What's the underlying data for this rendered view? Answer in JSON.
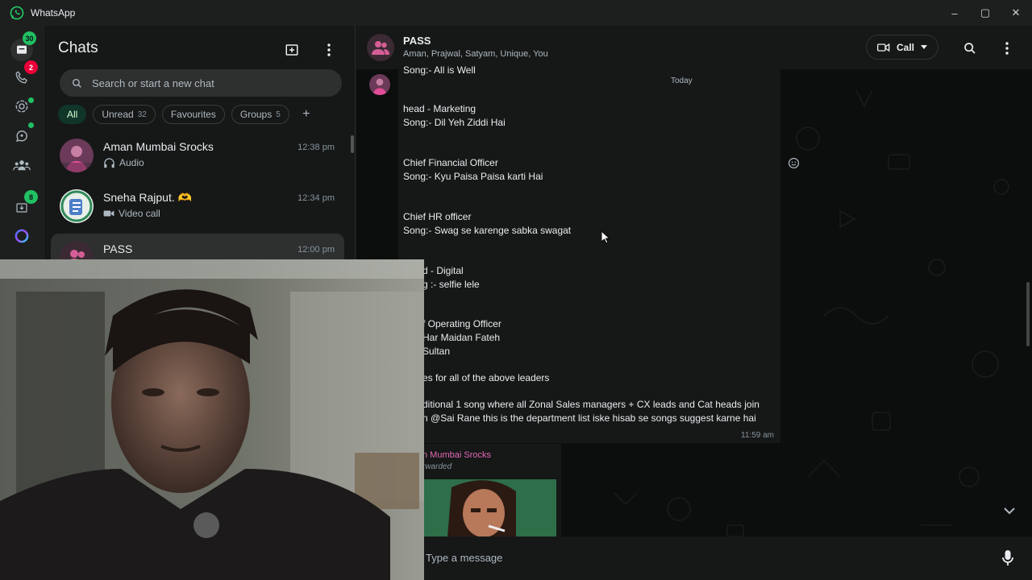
{
  "app": {
    "title": "WhatsApp",
    "brand_color": "#25d366"
  },
  "window_controls": {
    "minimize": "–",
    "maximize": "▢",
    "close": "✕"
  },
  "rail": {
    "chats_badge": "30",
    "calls_badge": "2",
    "archive_badge": "8",
    "icons": [
      "chats-icon",
      "calls-icon",
      "status-icon",
      "channels-icon",
      "communities-icon",
      "archive-icon",
      "meta-ai-icon"
    ]
  },
  "chat_list": {
    "title": "Chats",
    "search_placeholder": "Search or start a new chat",
    "filters": [
      {
        "label": "All",
        "count": ""
      },
      {
        "label": "Unread",
        "count": "32"
      },
      {
        "label": "Favourites",
        "count": ""
      },
      {
        "label": "Groups",
        "count": "5"
      }
    ],
    "add_filter": "+",
    "items": [
      {
        "name": "Aman Mumbai Srocks",
        "time": "12:38 pm",
        "preview": "Audio",
        "preview_icon": "headphones-icon"
      },
      {
        "name": "Sneha Rajput. 🫶",
        "time": "12:34 pm",
        "preview": "Video call",
        "preview_icon": "video-icon"
      },
      {
        "name": "PASS",
        "time": "12:00 pm",
        "preview": "",
        "preview_icon": ""
      }
    ]
  },
  "conversation": {
    "name": "PASS",
    "members": "Aman, Prajwal, Satyam, Unique, You",
    "call_label": "Call",
    "date_chip": "Today",
    "message_lines": [
      "Song:- All is Well",
      "head -  Marketing",
      "Song:- Dil Yeh Ziddi Hai",
      "Chief Financial Officer",
      "Song:- Kyu Paisa Paisa karti Hai",
      "Chief HR officer",
      "Song:- Swag se karenge sabka swagat",
      "d - Digital",
      "g :- selfie lele",
      "f Operating Officer",
      "Har Maidan Fateh",
      "Sultan",
      "es for all of the above leaders",
      "ditional 1 song where all Zonal Sales managers + CX leads and Cat heads join",
      "n @Sai Rane this is the department list iske hisab se songs suggest karne hai"
    ],
    "message_time": "11:59 am",
    "forwarded_sender": "n Mumbai Srocks",
    "forwarded_label": "rwarded",
    "compose_placeholder": "Type a message"
  }
}
